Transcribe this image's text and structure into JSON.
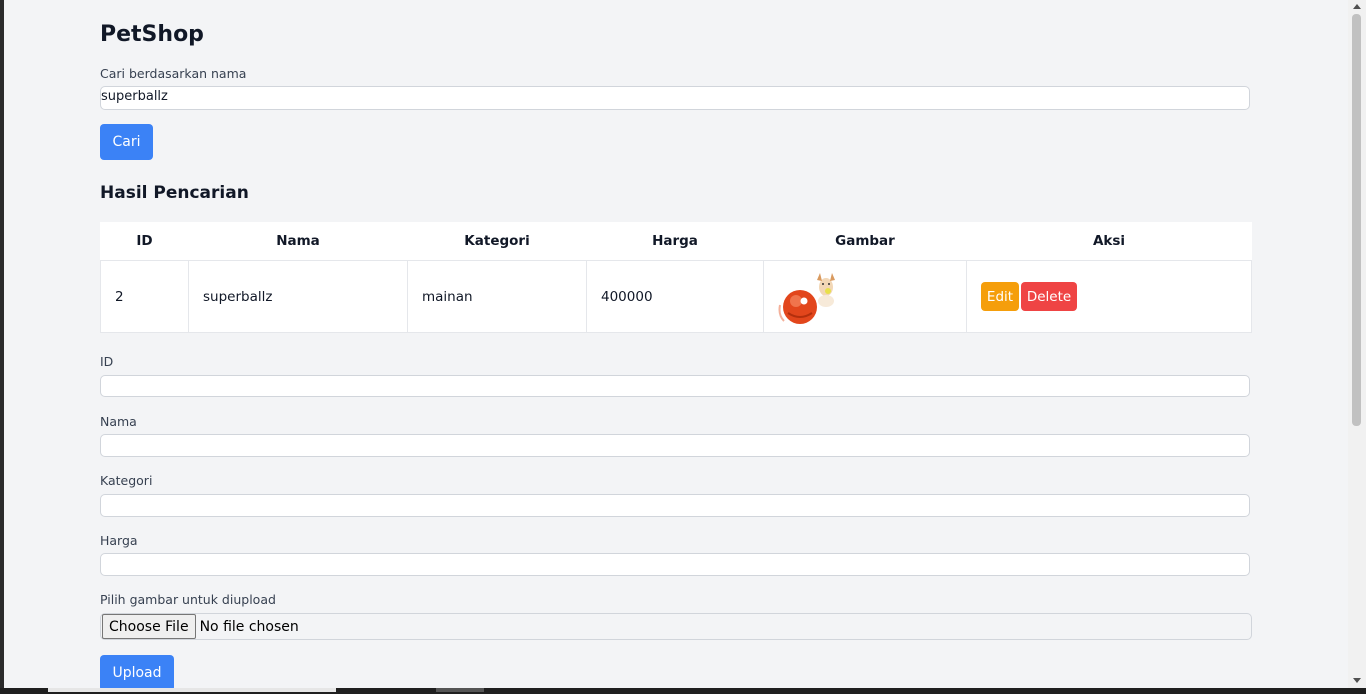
{
  "app": {
    "title": "PetShop"
  },
  "search": {
    "label": "Cari berdasarkan nama",
    "value": "superballz",
    "button_label": "Cari"
  },
  "results": {
    "heading": "Hasil Pencarian",
    "columns": [
      "ID",
      "Nama",
      "Kategori",
      "Harga",
      "Gambar",
      "Aksi"
    ],
    "rows": [
      {
        "id": "2",
        "nama": "superballz",
        "kategori": "mainan",
        "harga": "400000",
        "gambar_icon": "ball-toy-dog-image",
        "edit_label": "Edit",
        "delete_label": "Delete"
      }
    ]
  },
  "form": {
    "id_label": "ID",
    "nama_label": "Nama",
    "kategori_label": "Kategori",
    "harga_label": "Harga",
    "file_label": "Pilih gambar untuk diupload",
    "file_button": "Choose File",
    "file_status": "No file chosen",
    "upload_label": "Upload"
  },
  "colors": {
    "primary": "#3b82f6",
    "edit": "#f59e0b",
    "delete": "#ef4444",
    "background": "#f3f4f6"
  }
}
